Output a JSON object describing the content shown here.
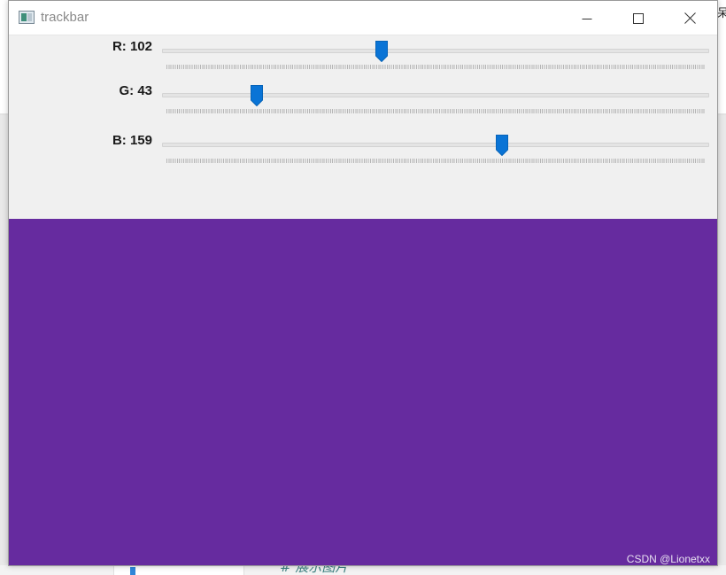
{
  "background": {
    "corner_glyph": "呆",
    "bottom_text": "# 展示图片"
  },
  "window": {
    "title": "trackbar",
    "app_icon": "opencv-window-icon",
    "caption_buttons": [
      "minimize-icon",
      "maximize-icon",
      "close-icon"
    ]
  },
  "trackbars": [
    {
      "label": "R: 102",
      "channel": "R",
      "value": 102,
      "max": 255
    },
    {
      "label": "G: 43",
      "channel": "G",
      "value": 43,
      "max": 255
    },
    {
      "label": "B: 159",
      "channel": "B",
      "value": 159,
      "max": 255
    }
  ],
  "preview": {
    "color": "#662B9F"
  },
  "watermark": "CSDN @Lionetxx",
  "colors": {
    "thumb": "#0a74d6",
    "title_text": "#8a8a8a"
  }
}
